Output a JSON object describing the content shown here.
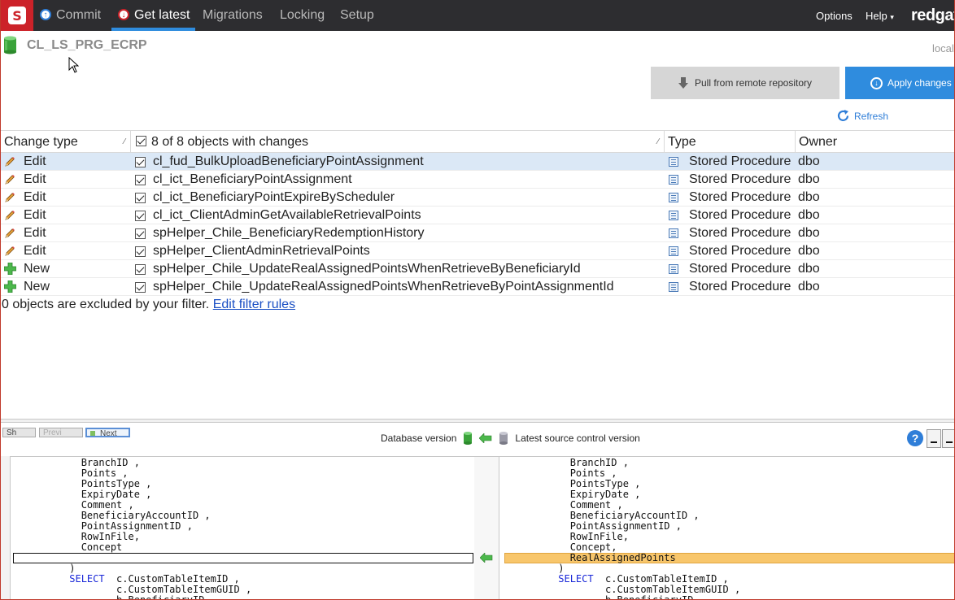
{
  "nav": {
    "tabs": [
      {
        "label": "Commit",
        "icon": "commit-icon"
      },
      {
        "label": "Get latest",
        "icon": "get-latest-icon",
        "active": true
      },
      {
        "label": "Migrations"
      },
      {
        "label": "Locking"
      },
      {
        "label": "Setup"
      }
    ],
    "options_label": "Options",
    "help_label": "Help",
    "help_caret": "▾",
    "brand": "redgat"
  },
  "header": {
    "database_name": "CL_LS_PRG_ECRP",
    "server_label": "local",
    "pull_button_label": "Pull from remote repository",
    "apply_button_label": "Apply changes",
    "refresh_label": "Refresh"
  },
  "table": {
    "columns": {
      "change_type": "Change type",
      "objects": "8 of 8 objects with changes",
      "type": "Type",
      "owner": "Owner"
    },
    "sort_glyph": "⁄",
    "rows": [
      {
        "change": "Edit",
        "icon": "pencil-icon",
        "name": "cl_fud_BulkUploadBeneficiaryPointAssignment",
        "type": "Stored Procedure",
        "owner": "dbo",
        "checked": true,
        "selected": true
      },
      {
        "change": "Edit",
        "icon": "pencil-icon",
        "name": "cl_ict_BeneficiaryPointAssignment",
        "type": "Stored Procedure",
        "owner": "dbo",
        "checked": true
      },
      {
        "change": "Edit",
        "icon": "pencil-icon",
        "name": "cl_ict_BeneficiaryPointExpireByScheduler",
        "type": "Stored Procedure",
        "owner": "dbo",
        "checked": true
      },
      {
        "change": "Edit",
        "icon": "pencil-icon",
        "name": "cl_ict_ClientAdminGetAvailableRetrievalPoints",
        "type": "Stored Procedure",
        "owner": "dbo",
        "checked": true
      },
      {
        "change": "Edit",
        "icon": "pencil-icon",
        "name": "spHelper_Chile_BeneficiaryRedemptionHistory",
        "type": "Stored Procedure",
        "owner": "dbo",
        "checked": true
      },
      {
        "change": "Edit",
        "icon": "pencil-icon",
        "name": "spHelper_ClientAdminRetrievalPoints",
        "type": "Stored Procedure",
        "owner": "dbo",
        "checked": true
      },
      {
        "change": "New",
        "icon": "plus-icon",
        "name": "spHelper_Chile_UpdateRealAssignedPointsWhenRetrieveByBeneficiaryId",
        "type": "Stored Procedure",
        "owner": "dbo",
        "checked": true
      },
      {
        "change": "New",
        "icon": "plus-icon",
        "name": "spHelper_Chile_UpdateRealAssignedPointsWhenRetrieveByPointAssignmentId",
        "type": "Stored Procedure",
        "owner": "dbo",
        "checked": true
      }
    ],
    "filter_text": "0 objects are excluded by your filter.",
    "filter_link": "Edit filter rules"
  },
  "diff": {
    "buttons": [
      "Sh",
      "Previ",
      "Next"
    ],
    "database_version_label": "Database version",
    "source_version_label": "Latest source control version",
    "help_glyph": "?",
    "left_lines": [
      "            BranchID ,",
      "            Points ,",
      "            PointsType ,",
      "            ExpiryDate ,",
      "            Comment ,",
      "            BeneficiaryAccountID ,",
      "            PointAssignmentID ,",
      "            RowInFile,",
      "            Concept",
      "",
      "          )",
      "          SELECT  c.CustomTableItemID ,",
      "                  c.CustomTableItemGUID ,",
      "                  b.BeneficiaryID ,"
    ],
    "right_lines": [
      "            BranchID ,",
      "            Points ,",
      "            PointsType ,",
      "            ExpiryDate ,",
      "            Comment ,",
      "            BeneficiaryAccountID ,",
      "            PointAssignmentID ,",
      "            RowInFile,",
      "            Concept,",
      "            RealAssignedPoints",
      "          )",
      "          SELECT  c.CustomTableItemID ,",
      "                  c.CustomTableItemGUID ,",
      "                  b.BeneficiaryID ,"
    ]
  }
}
